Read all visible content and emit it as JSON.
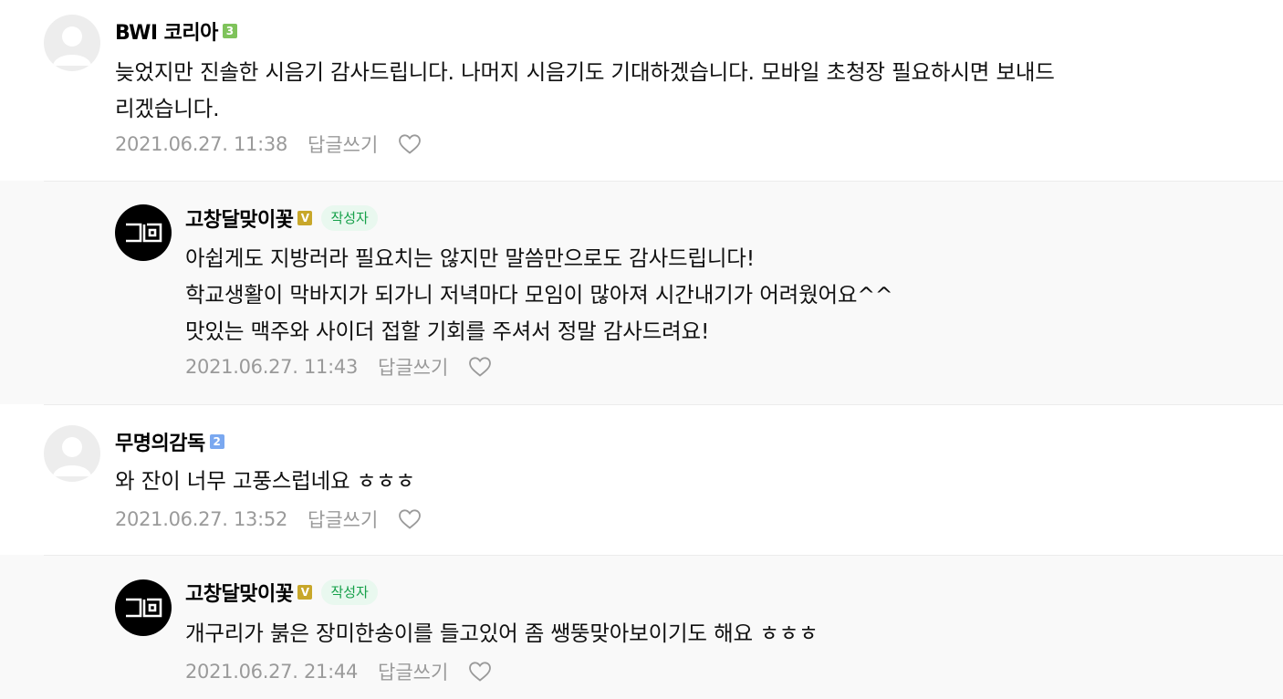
{
  "comments": [
    {
      "nickname": "BWI 코리아",
      "level": "3",
      "lines": [
        "늦었지만 진솔한 시음기 감사드립니다. 나머지 시음기도 기대하겠습니다. 모바일 초청장 필요하시면 보내드",
        "리겠습니다."
      ],
      "date": "2021.06.27. 11:38",
      "reply_label": "답글쓰기"
    },
    {
      "nickname": "고창달맞이꽃",
      "level": "V",
      "author_badge": "작성자",
      "lines": [
        "아쉽게도 지방러라 필요치는 않지만 말씀만으로도 감사드립니다!",
        "학교생활이 막바지가 되가니 저녁마다 모임이 많아져 시간내기가 어려웠어요^^",
        "맛있는 맥주와 사이더 접할 기회를 주셔서 정말 감사드려요!"
      ],
      "date": "2021.06.27. 11:43",
      "reply_label": "답글쓰기"
    },
    {
      "nickname": "무명의감독",
      "level": "2",
      "lines": [
        "와 잔이 너무 고풍스럽네요 ㅎㅎㅎ"
      ],
      "date": "2021.06.27. 13:52",
      "reply_label": "답글쓰기"
    },
    {
      "nickname": "고창달맞이꽃",
      "level": "V",
      "author_badge": "작성자",
      "lines": [
        "개구리가 붉은 장미한송이를 들고있어 좀 쌩뚱맞아보이기도 해요 ㅎㅎㅎ"
      ],
      "date": "2021.06.27. 21:44",
      "reply_label": "답글쓰기"
    }
  ],
  "icons": {
    "like": "heart-outline-icon",
    "default_avatar": "person-silhouette-icon",
    "owner_avatar": "gd-logo"
  },
  "colors": {
    "reply_background": "#f9f9f9",
    "author_badge_bg": "#e9f8ef",
    "author_badge_text": "#15a049",
    "meta_text": "#9a9a9a"
  }
}
